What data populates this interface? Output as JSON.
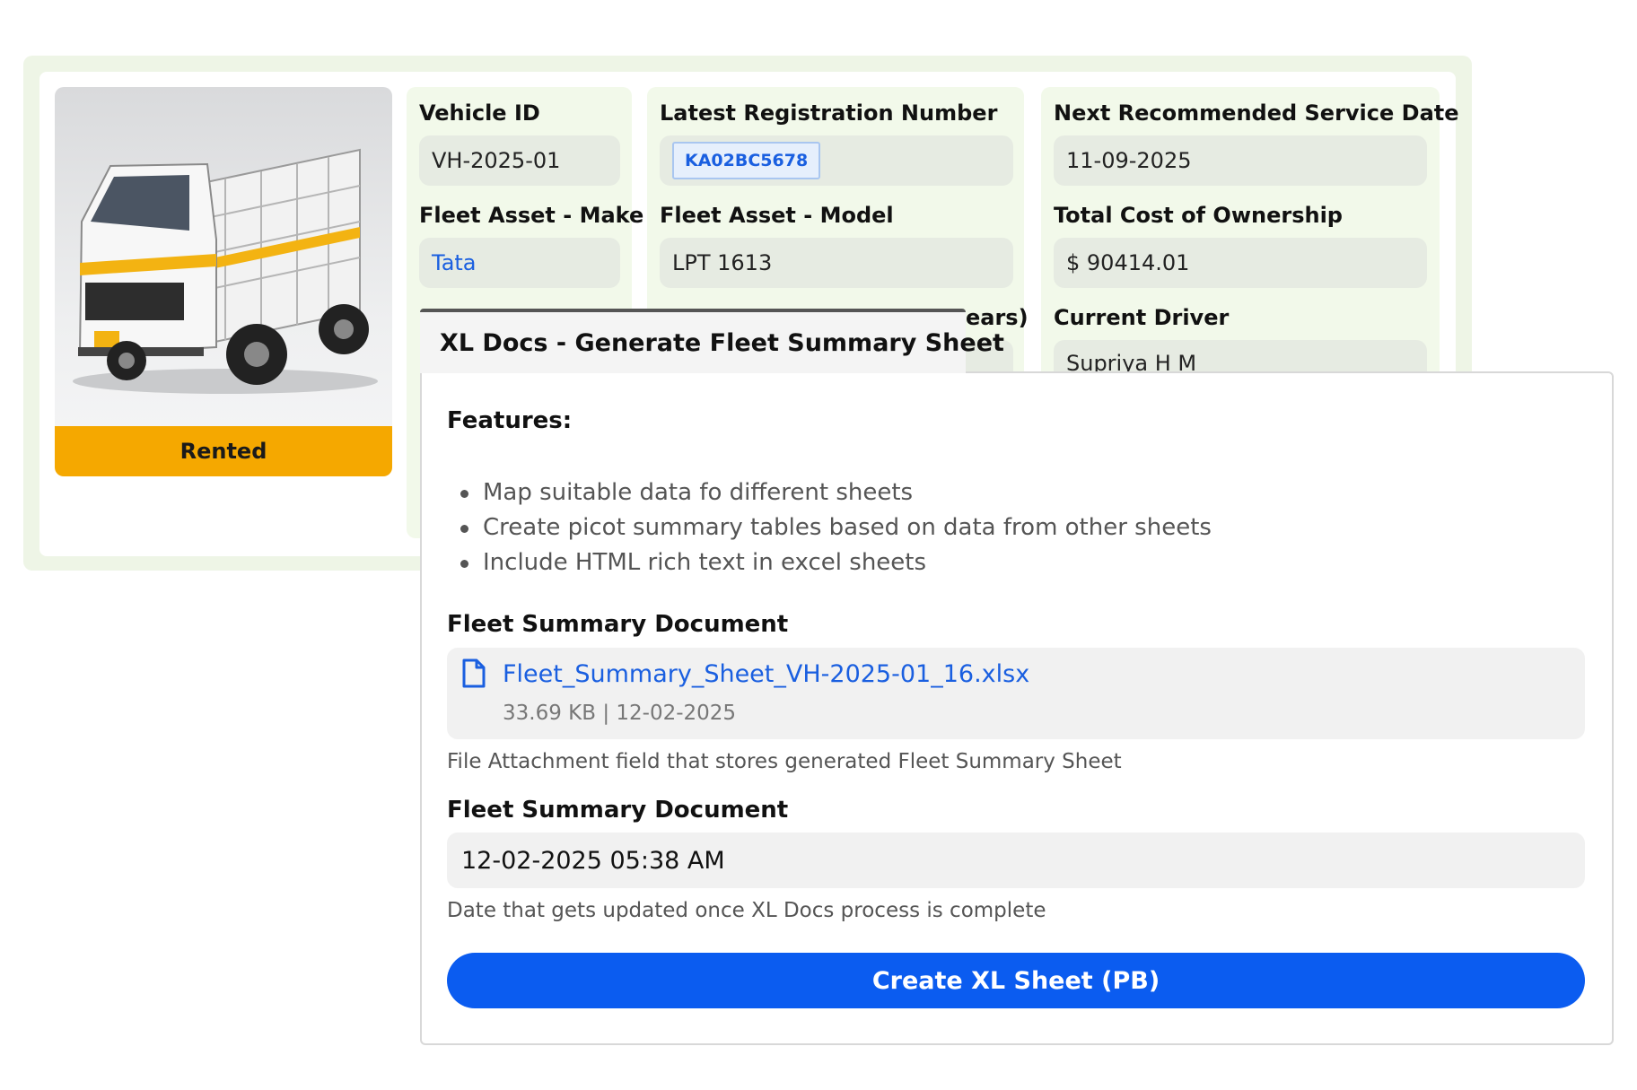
{
  "vehicle": {
    "status": "Rented",
    "fields": {
      "vehicle_id": {
        "label": "Vehicle ID",
        "value": "VH-2025-01"
      },
      "registration": {
        "label": "Latest Registration Number",
        "value": "KA02BC5678"
      },
      "service_date": {
        "label": "Next Recommended Service Date",
        "value": "11-09-2025"
      },
      "make": {
        "label": "Fleet Asset - Make",
        "value": "Tata"
      },
      "model": {
        "label": "Fleet Asset - Model",
        "value": "LPT 1613"
      },
      "tco": {
        "label": "Total Cost of Ownership",
        "value": "$ 90414.01"
      },
      "hidden_partial": {
        "label": "ears)"
      },
      "driver": {
        "label": "Current Driver",
        "value": "Supriya H M"
      }
    }
  },
  "modal": {
    "title": "XL Docs - Generate Fleet Summary Sheet",
    "features_heading": "Features:",
    "features": [
      "Map suitable data fo different sheets",
      "Create picot summary tables based on data from other sheets",
      "Include HTML rich text in excel sheets"
    ],
    "doc_section": {
      "label": "Fleet Summary Document",
      "file_name": "Fleet_Summary_Sheet_VH-2025-01_16.xlsx",
      "file_meta": "33.69 KB | 12-02-2025",
      "help": "File Attachment field that stores generated Fleet Summary Sheet",
      "icon": "file-icon"
    },
    "date_section": {
      "label": "Fleet Summary Document",
      "value": "12-02-2025 05:38 AM",
      "help": "Date that gets updated once XL Docs process is complete"
    },
    "button_label": "Create XL Sheet (PB)"
  },
  "colors": {
    "accent": "#0b5cf0",
    "status_badge": "#f5a800",
    "card_bg": "#f2f9ea",
    "link": "#1a5fe0"
  }
}
